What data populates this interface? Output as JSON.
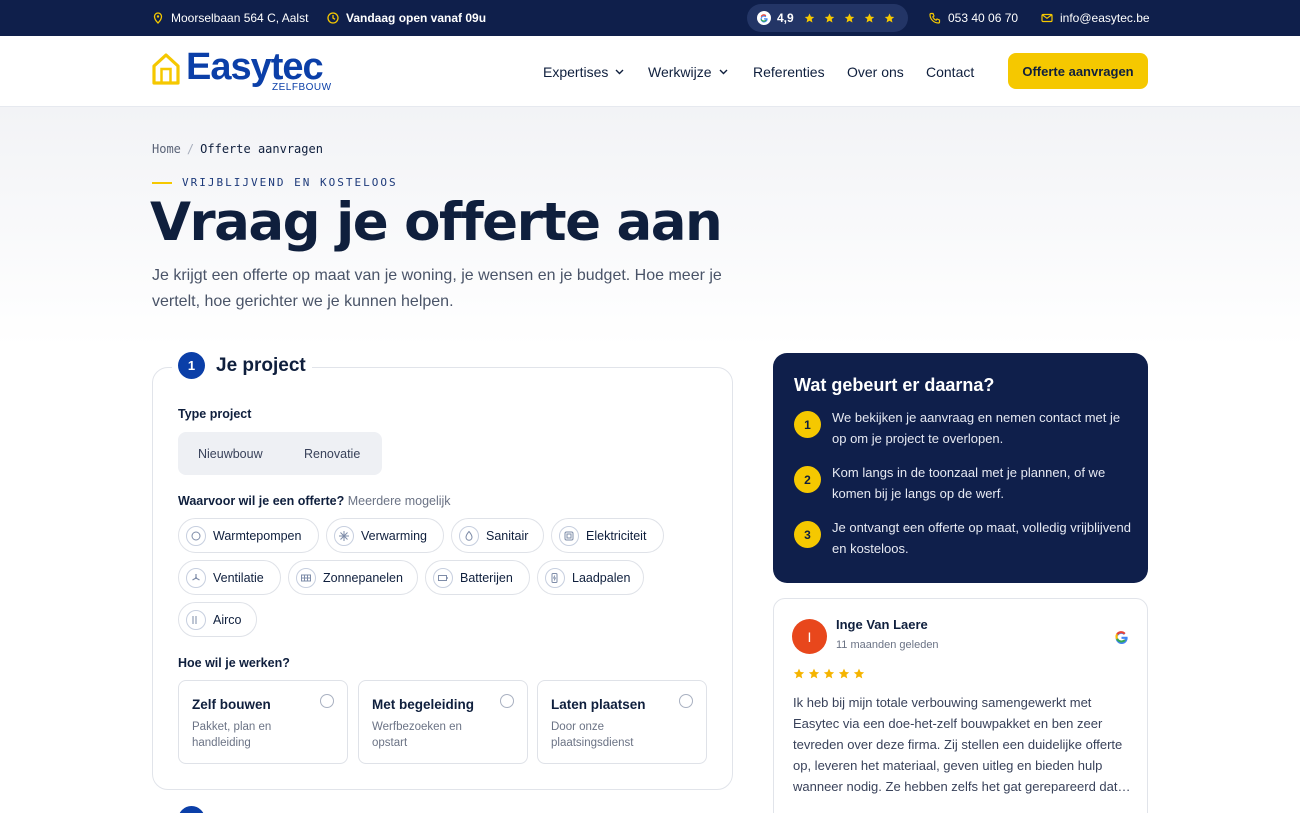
{
  "topbar": {
    "address": "Moorselbaan 564 C, Aalst",
    "hours": "Vandaag open vanaf 09u",
    "rating": "4,9",
    "phone": "053 40 06 70",
    "email": "info@easytec.be"
  },
  "header": {
    "logo_word": "Easytec",
    "logo_sub": "ZELFBOUW",
    "nav": [
      "Expertises",
      "Werkwijze",
      "Referenties",
      "Over ons",
      "Contact"
    ],
    "cta": "Offerte aanvragen"
  },
  "breadcrumb": {
    "home": "Home",
    "sep": "/",
    "current": "Offerte aanvragen"
  },
  "hero": {
    "eyebrow": "VRIJBLIJVEND EN KOSTELOOS",
    "title": "Vraag je offerte aan",
    "lead": "Je krijgt een offerte op maat van je woning, je wensen en je budget. Hoe meer je vertelt, hoe gerichter we je kunnen helpen."
  },
  "form": {
    "step_number": "1",
    "step_title": "Je project",
    "type_label": "Type project",
    "type_options": [
      "Nieuwbouw",
      "Renovatie"
    ],
    "scope_label": "Waarvoor wil je een offerte?",
    "scope_hint": "Meerdere mogelijk",
    "scope_options": [
      {
        "label": "Warmtepompen",
        "icon": "heat-pump-icon"
      },
      {
        "label": "Verwarming",
        "icon": "heating-icon"
      },
      {
        "label": "Sanitair",
        "icon": "water-drop-icon"
      },
      {
        "label": "Elektriciteit",
        "icon": "electricity-icon"
      },
      {
        "label": "Ventilatie",
        "icon": "ventilation-icon"
      },
      {
        "label": "Zonnepanelen",
        "icon": "solar-panel-icon"
      },
      {
        "label": "Batterijen",
        "icon": "battery-icon"
      },
      {
        "label": "Laadpalen",
        "icon": "charging-station-icon"
      },
      {
        "label": "Airco",
        "icon": "airco-icon"
      }
    ],
    "mode_label": "Hoe wil je werken?",
    "modes": [
      {
        "title": "Zelf bouwen",
        "desc": "Pakket, plan en handleiding"
      },
      {
        "title": "Met begeleiding",
        "desc": "Werfbezoeken en opstart"
      },
      {
        "title": "Laten plaatsen",
        "desc": "Door onze plaatsingsdienst"
      }
    ]
  },
  "next_steps": {
    "title": "Wat gebeurt er daarna?",
    "items": [
      {
        "n": "1",
        "text": "We bekijken je aanvraag en nemen contact met je op om je project te overlopen."
      },
      {
        "n": "2",
        "text": "Kom langs in de toonzaal met je plannen, of we komen bij je langs op de werf."
      },
      {
        "n": "3",
        "text": "Je ontvangt een offerte op maat, volledig vrijblijvend en kosteloos."
      }
    ]
  },
  "review": {
    "initial": "I",
    "name": "Inge Van Laere",
    "date": "11 maanden geleden",
    "stars": 5,
    "text": "Ik heb bij mijn totale verbouwing samengewerkt met Easytec via een doe-het-zelf bouwpakket en ben zeer tevreden over deze firma. Zij stellen een duidelijke offerte op, leveren het materiaal, geven uitleg en bieden hulp wanneer nodig. Ze hebben zelfs het gat gerepareerd dat…"
  },
  "colors": {
    "navy": "#0f1f4b",
    "blue": "#0b3fa8",
    "yellow": "#f5c800"
  }
}
